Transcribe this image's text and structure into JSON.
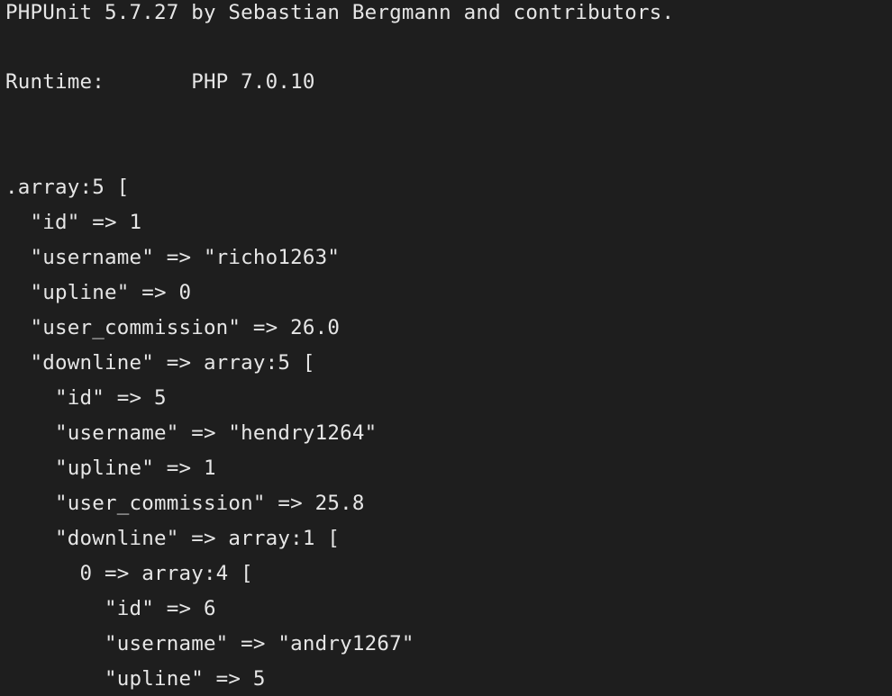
{
  "terminal": {
    "lines": [
      "PHPUnit 5.7.27 by Sebastian Bergmann and contributors.",
      "Runtime:       PHP 7.0.10",
      ".array:5 [",
      "  \"id\" => 1",
      "  \"username\" => \"richo1263\"",
      "  \"upline\" => 0",
      "  \"user_commission\" => 26.0",
      "  \"downline\" => array:5 [",
      "    \"id\" => 5",
      "    \"username\" => \"hendry1264\"",
      "    \"upline\" => 1",
      "    \"user_commission\" => 25.8",
      "    \"downline\" => array:1 [",
      "      0 => array:4 [",
      "        \"id\" => 6",
      "        \"username\" => \"andry1267\"",
      "        \"upline\" => 5"
    ],
    "colors": {
      "background": "#1e1e1e",
      "text": "#e6e6e6"
    }
  }
}
